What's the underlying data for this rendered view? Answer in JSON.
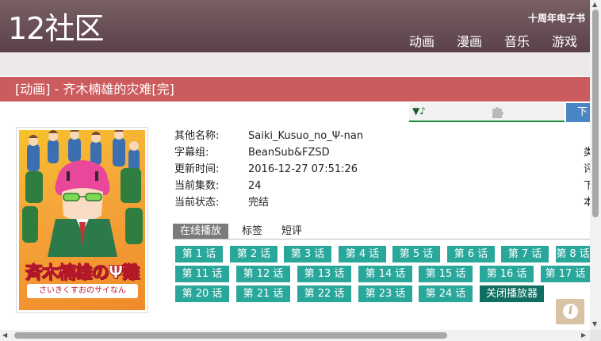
{
  "header": {
    "logo": "12社区",
    "top_link": "十周年电子书",
    "nav": [
      "动画",
      "漫画",
      "音乐",
      "游戏"
    ]
  },
  "title_bar": "[动画] - 齐木楠雄的灾难[完]",
  "player": {
    "music_icon": "▼♪",
    "puzzle_icon": "puzzle-icon",
    "download_label": "下"
  },
  "cover": {
    "title": "斉木楠雄のΨ難",
    "subtitle": "さいきくすおのサイなん"
  },
  "info": [
    {
      "label": "其他名称:",
      "value": "Saiki_Kusuo_no_Ψ-nan"
    },
    {
      "label": "字幕组:",
      "value": "BeanSub&FZSD"
    },
    {
      "label": "更新时间:",
      "value": "2016-12-27 07:51:26"
    },
    {
      "label": "当前集数:",
      "value": "24"
    },
    {
      "label": "当前状态:",
      "value": "完结"
    }
  ],
  "right_clipped": [
    "类",
    "评",
    "下",
    "本"
  ],
  "tabs": [
    "在线播放",
    "标签",
    "短评"
  ],
  "active_tab": "在线播放",
  "episodes": [
    "第 1 话",
    "第 2 话",
    "第 3 话",
    "第 4 话",
    "第 5 话",
    "第 6 话",
    "第 7 话",
    "第 8 话",
    "第 11 话",
    "第 12 话",
    "第 13 话",
    "第 14 话",
    "第 15 话",
    "第 16 话",
    "第 17 话",
    "第 20 话",
    "第 21 话",
    "第 22 话",
    "第 23 话",
    "第 24 话"
  ],
  "close_player": "关闭播放器",
  "info_button_icon": "info-icon",
  "info_button_glyph": "i",
  "colors": {
    "header": "#6b5056",
    "title_bar": "#cc5b5d",
    "episode": "#2aa79b",
    "close_player": "#0f6d62",
    "download": "#4a86c5"
  }
}
